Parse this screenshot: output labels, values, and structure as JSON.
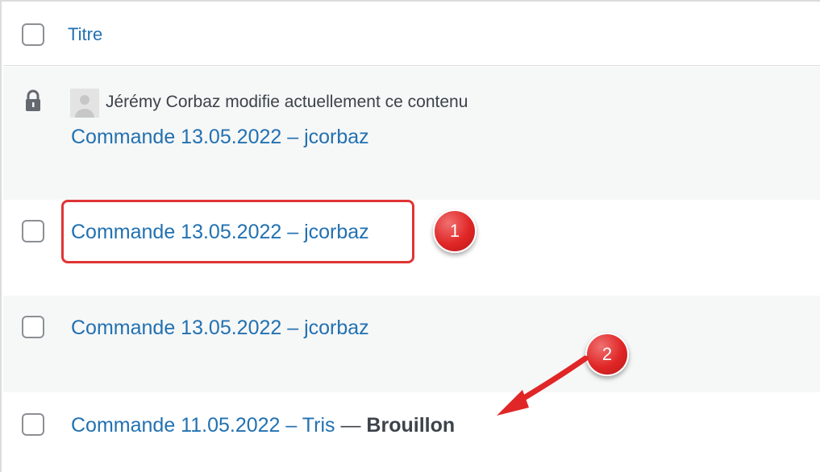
{
  "table": {
    "header": {
      "title_label": "Titre"
    },
    "locked_row": {
      "lock_message": "Jérémy Corbaz modifie actuellement ce contenu",
      "title": "Commande 13.05.2022 – jcorbaz"
    },
    "rows": [
      {
        "title": "Commande 13.05.2022 – jcorbaz"
      },
      {
        "title": "Commande 13.05.2022 – jcorbaz"
      },
      {
        "title": "Commande 11.05.2022 – Tris",
        "separator": " — ",
        "status": "Brouillon"
      }
    ]
  },
  "annotations": {
    "badge_1": "1",
    "badge_2": "2",
    "accent_color": "#e02626"
  },
  "colors": {
    "link": "#2271b1",
    "row_alt": "#f6f7f7",
    "text": "#3c434a"
  }
}
